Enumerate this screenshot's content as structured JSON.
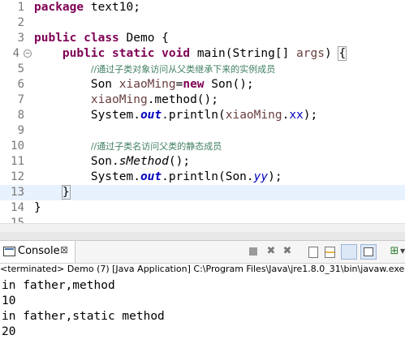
{
  "editor": {
    "current_line": 13,
    "lines": [
      {
        "n": "1",
        "code": "package text10;"
      },
      {
        "n": "2",
        "code": ""
      },
      {
        "n": "3",
        "code": "public class Demo {"
      },
      {
        "n": "4",
        "code": "    public static void main(String[] args) {"
      },
      {
        "n": "5",
        "code": "        //通过子类对象访问从父类继承下来的实例成员"
      },
      {
        "n": "6",
        "code": "        Son xiaoMing=new Son();"
      },
      {
        "n": "7",
        "code": "        xiaoMing.method();"
      },
      {
        "n": "8",
        "code": "        System.out.println(xiaoMing.xx);"
      },
      {
        "n": "9",
        "code": ""
      },
      {
        "n": "10",
        "code": "        //通过子类名访问父类的静态成员"
      },
      {
        "n": "11",
        "code": "        Son.sMethod();"
      },
      {
        "n": "12",
        "code": "        System.out.println(Son.yy);"
      },
      {
        "n": "13",
        "code": "    }"
      },
      {
        "n": "14",
        "code": "}"
      },
      {
        "n": "15",
        "code": ""
      }
    ],
    "tokens": {
      "kw_package": "package",
      "pkg_name": " text10;",
      "kw_public1": "public",
      "kw_class": "class",
      "class_name": " Demo {",
      "kw_public2": "public",
      "kw_static": "static",
      "kw_void": "void",
      "main_sig_a": " main(String[] ",
      "main_arg": "args",
      "main_sig_b": ") {",
      "comment1": "//通过子类对象访问从父类继承下来的实例成员",
      "l6_a": "Son ",
      "l6_var": "xiaoMing",
      "l6_eq": "=",
      "kw_new": "new",
      "l6_b": " Son();",
      "l7_var": "xiaoMing",
      "l7_b": ".method();",
      "l8_a": "System.",
      "l8_out": "out",
      "l8_b": ".println(",
      "l8_var": "xiaoMing",
      "l8_dot": ".",
      "l8_xx": "xx",
      "l8_c": ");",
      "comment2": "//通过子类名访问父类的静态成员",
      "l11_a": "Son.",
      "l11_m": "sMethod",
      "l11_b": "();",
      "l12_a": "System.",
      "l12_out": "out",
      "l12_b": ".println(Son.",
      "l12_yy": "yy",
      "l12_c": ");",
      "l13": "}",
      "l14": "}"
    }
  },
  "console": {
    "tab_label": "Console",
    "close_symbol": "⊠",
    "terminated_text": "<terminated> Demo (7) [Java Application] C:\\Program Files\\Java\\jre1.8.0_31\\bin\\javaw.exe",
    "output": [
      "in father,method",
      "10",
      "in father,static method",
      "20"
    ],
    "toolbar_icons": [
      "terminate-icon",
      "remove-launch-icon",
      "remove-all-terminated-icon",
      "clear-console-icon",
      "scroll-lock-icon",
      "pin-console-icon",
      "display-selected-console-icon",
      "open-console-icon"
    ]
  }
}
